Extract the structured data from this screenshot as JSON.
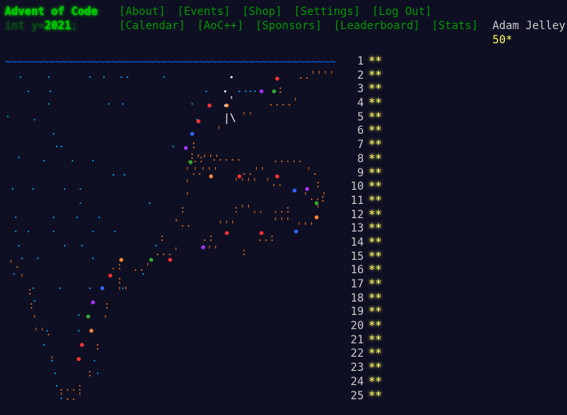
{
  "header": {
    "title": "Advent of Code",
    "year_prefix": "int y=",
    "year": "2021",
    "year_suffix": ";",
    "nav_row1": [
      {
        "label": "[About]",
        "name": "nav-about"
      },
      {
        "label": "[Events]",
        "name": "nav-events"
      },
      {
        "label": "[Shop]",
        "name": "nav-shop"
      },
      {
        "label": "[Settings]",
        "name": "nav-settings"
      },
      {
        "label": "[Log Out]",
        "name": "nav-logout"
      }
    ],
    "nav_row2": [
      {
        "label": "[Calendar]",
        "name": "nav-calendar"
      },
      {
        "label": "[AoC++]",
        "name": "nav-aocpp"
      },
      {
        "label": "[Sponsors]",
        "name": "nav-sponsors"
      },
      {
        "label": "[Leaderboard]",
        "name": "nav-leaderboard"
      },
      {
        "label": "[Stats]",
        "name": "nav-stats"
      }
    ],
    "user_name": "Adam Jelley",
    "star_count": "50*"
  },
  "calendar": {
    "wave": "~~~~~~~~~~~~~~~~~~~~~~~~~~~~~~~~~~~~~~~~~~~~~~~~~~~~~~~~~~~~~~~~~~~~~~~~~",
    "days": [
      {
        "day": "1",
        "stars": "**"
      },
      {
        "day": "2",
        "stars": "**"
      },
      {
        "day": "3",
        "stars": "**"
      },
      {
        "day": "4",
        "stars": "**"
      },
      {
        "day": "5",
        "stars": "**"
      },
      {
        "day": "6",
        "stars": "**"
      },
      {
        "day": "7",
        "stars": "**"
      },
      {
        "day": "8",
        "stars": "**"
      },
      {
        "day": "9",
        "stars": "**"
      },
      {
        "day": "10",
        "stars": "**"
      },
      {
        "day": "11",
        "stars": "**"
      },
      {
        "day": "12",
        "stars": "**"
      },
      {
        "day": "13",
        "stars": "**"
      },
      {
        "day": "14",
        "stars": "**"
      },
      {
        "day": "15",
        "stars": "**"
      },
      {
        "day": "16",
        "stars": "**"
      },
      {
        "day": "17",
        "stars": "**"
      },
      {
        "day": "18",
        "stars": "**"
      },
      {
        "day": "19",
        "stars": "**"
      },
      {
        "day": "20",
        "stars": "**"
      },
      {
        "day": "21",
        "stars": "**"
      },
      {
        "day": "22",
        "stars": "**"
      },
      {
        "day": "23",
        "stars": "**"
      },
      {
        "day": "24",
        "stars": "**"
      },
      {
        "day": "25",
        "stars": "**"
      }
    ]
  },
  "colors": {
    "background": "#0f0f23",
    "title_green": "#00cc00",
    "link_green": "#009900",
    "gold": "#ffff66",
    "wave_blue": "#0066ff",
    "text": "#cccccc",
    "art_orange": "#d2691e",
    "art_cyan": "#00aaff"
  }
}
